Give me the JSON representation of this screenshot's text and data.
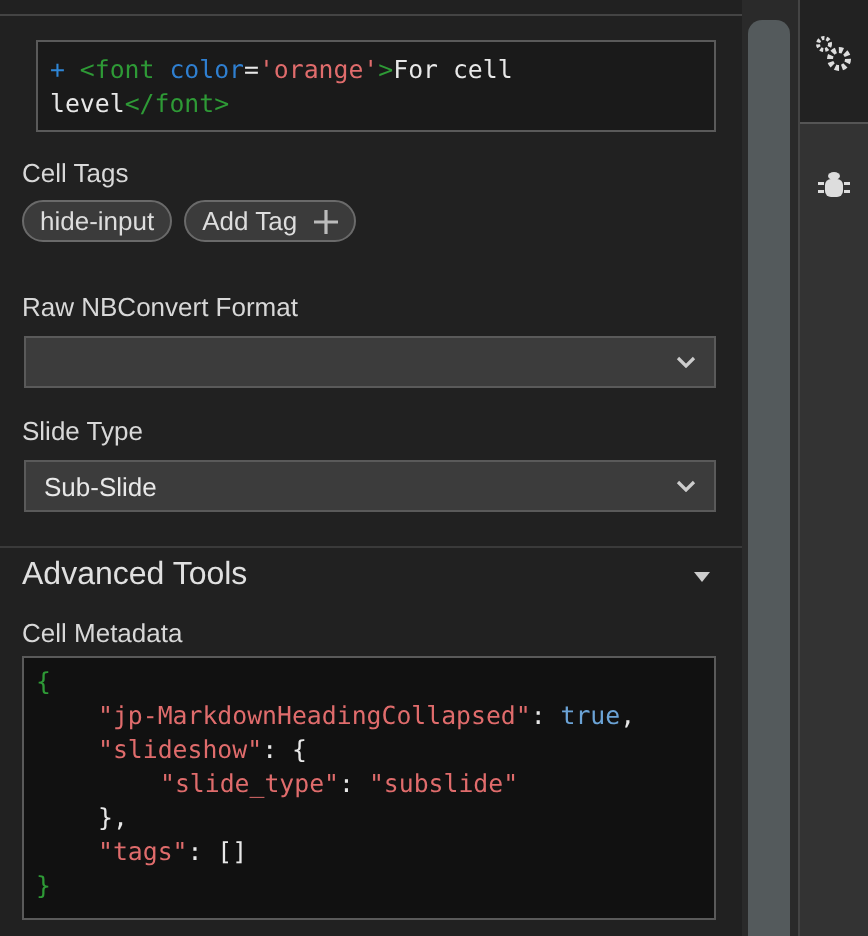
{
  "markdown_preview": {
    "lines": [
      [
        {
          "kind": "op",
          "text": "+ "
        },
        {
          "kind": "tag",
          "text": "<font"
        },
        {
          "kind": "attr",
          "text": " color"
        },
        {
          "kind": "plain",
          "text": "="
        },
        {
          "kind": "string",
          "text": "'orange'"
        },
        {
          "kind": "tag",
          "text": ">"
        },
        {
          "kind": "plain",
          "text": "For cell"
        }
      ],
      [
        {
          "kind": "plain",
          "text": "level"
        },
        {
          "kind": "tag",
          "text": "</font>"
        }
      ]
    ]
  },
  "cell_tags": {
    "label": "Cell Tags",
    "tags": [
      "hide-input"
    ],
    "add_button": "Add Tag"
  },
  "raw_format": {
    "label": "Raw NBConvert Format"
  },
  "slide_type": {
    "label": "Slide Type",
    "value": "Sub-Slide"
  },
  "advanced_tools": {
    "title": "Advanced Tools",
    "expanded": true
  },
  "cell_metadata": {
    "label": "Cell Metadata",
    "lines": [
      {
        "tokens": [
          {
            "kind": "bracket",
            "text": "{"
          }
        ],
        "children": [
          {
            "tokens": [
              {
                "kind": "string",
                "text": "\"jp-MarkdownHeadingCollapsed\""
              },
              {
                "kind": "plain",
                "text": ": "
              },
              {
                "kind": "keyword",
                "text": "true"
              },
              {
                "kind": "plain",
                "text": ","
              }
            ]
          },
          {
            "tokens": [
              {
                "kind": "string",
                "text": "\"slideshow\""
              },
              {
                "kind": "plain",
                "text": ": {"
              }
            ],
            "children": [
              {
                "tokens": [
                  {
                    "kind": "string",
                    "text": "\"slide_type\""
                  },
                  {
                    "kind": "plain",
                    "text": ": "
                  },
                  {
                    "kind": "string",
                    "text": "\"subslide\""
                  }
                ]
              }
            ],
            "close": [
              {
                "kind": "plain",
                "text": "},"
              }
            ]
          },
          {
            "tokens": [
              {
                "kind": "string",
                "text": "\"tags\""
              },
              {
                "kind": "plain",
                "text": ": []"
              }
            ]
          }
        ],
        "close": [
          {
            "kind": "bracket",
            "text": "}"
          }
        ]
      }
    ]
  },
  "sidebar_tabs": [
    {
      "kind": "gears",
      "selected": true
    },
    {
      "kind": "bug",
      "selected": false
    }
  ]
}
